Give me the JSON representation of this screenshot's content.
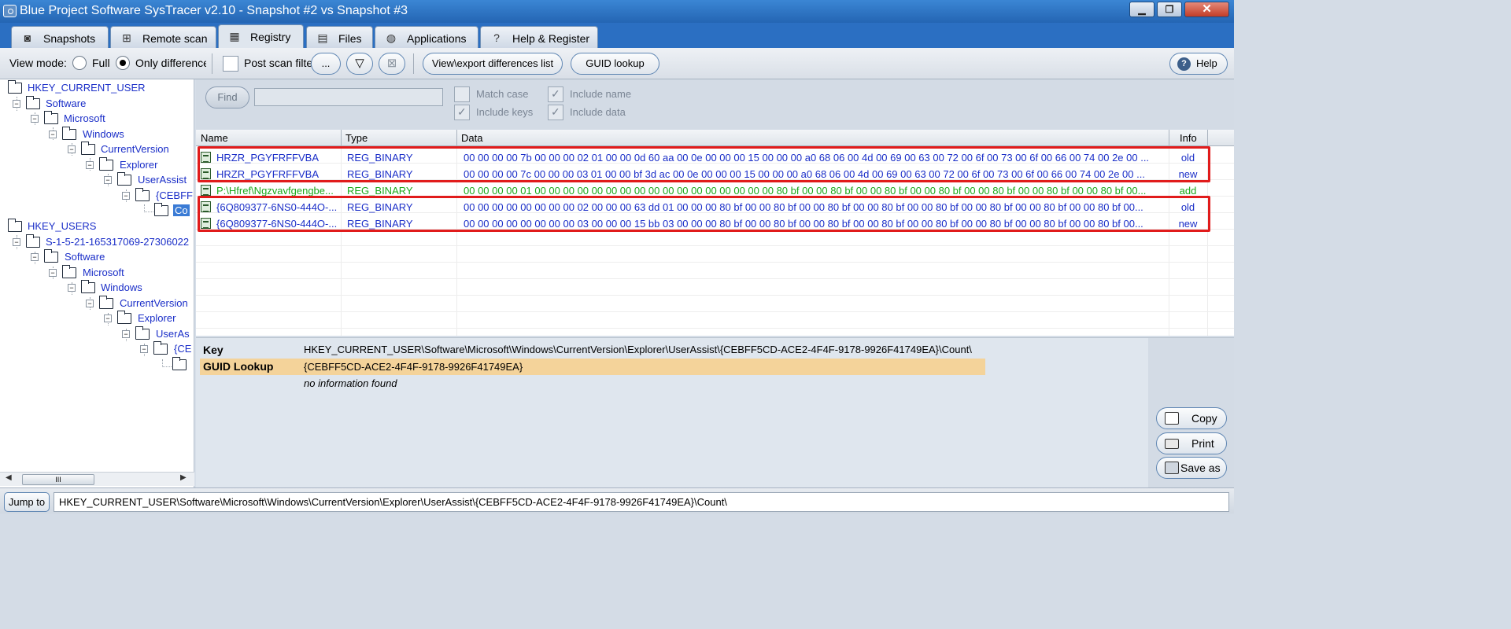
{
  "window": {
    "title": "Blue Project Software SysTracer v2.10 - Snapshot #2 vs Snapshot #3",
    "minimize": "▁",
    "maximize": "❐",
    "close": "✕"
  },
  "tabs": [
    {
      "label": "Snapshots",
      "icon": "camera-icon",
      "glyph": "◙"
    },
    {
      "label": "Remote scan",
      "icon": "network-icon",
      "glyph": "⊞"
    },
    {
      "label": "Registry",
      "icon": "registry-icon",
      "glyph": "▦"
    },
    {
      "label": "Files",
      "icon": "files-icon",
      "glyph": "▤"
    },
    {
      "label": "Applications",
      "icon": "applications-icon",
      "glyph": "◍"
    },
    {
      "label": "Help & Register",
      "icon": "help-icon",
      "glyph": "?"
    }
  ],
  "toolbar": {
    "view_mode_label": "View mode:",
    "full_label": "Full",
    "only_diff_label": "Only differences",
    "view_mode_selected": "Only differences",
    "post_scan_label": "Post scan filte",
    "post_scan_checked": false,
    "more_label": "...",
    "filter_glyph": "▽",
    "clear_filter_glyph": "⊠",
    "view_export_label": "View\\export differences list",
    "guid_lookup_label": "GUID lookup",
    "help_label": "Help",
    "help_glyph": "?"
  },
  "tree": {
    "nodes": [
      {
        "label": "HKEY_CURRENT_USER"
      },
      {
        "label": "Software"
      },
      {
        "label": "Microsoft"
      },
      {
        "label": "Windows"
      },
      {
        "label": "CurrentVersion"
      },
      {
        "label": "Explorer"
      },
      {
        "label": "UserAssist"
      },
      {
        "label": "{CEBFF"
      },
      {
        "label": "Co"
      },
      {
        "label": "HKEY_USERS"
      },
      {
        "label": "S-1-5-21-165317069-27306022"
      },
      {
        "label": "Software"
      },
      {
        "label": "Microsoft"
      },
      {
        "label": "Windows"
      },
      {
        "label": "CurrentVersion"
      },
      {
        "label": "Explorer"
      },
      {
        "label": "UserAs"
      },
      {
        "label": "{CE"
      },
      {
        "label": ""
      }
    ],
    "scroll_grip": "III",
    "scroll_left": "◀",
    "scroll_right": "▶"
  },
  "find": {
    "button_label": "Find",
    "value": "",
    "match_case": {
      "label": "Match case",
      "checked": false
    },
    "include_name": {
      "label": "Include name",
      "checked": true
    },
    "include_keys": {
      "label": "Include keys",
      "checked": true
    },
    "include_data": {
      "label": "Include data",
      "checked": true
    }
  },
  "grid": {
    "columns": [
      "Name",
      "Type",
      "Data",
      "Info"
    ],
    "rows": [
      {
        "name": "HRZR_PGYFRFFVBA",
        "type": "REG_BINARY",
        "data": "00 00 00 00 7b 00 00 00 02 01 00 00 0d 60 aa 00 0e 00 00 00 15 00 00 00 a0 68 06 00 4d 00 69 00 63 00 72 00 6f 00 73 00 6f 00 66 00 74 00 2e 00 ...",
        "info": "old",
        "color": "#1a2ec8"
      },
      {
        "name": "HRZR_PGYFRFFVBA",
        "type": "REG_BINARY",
        "data": "00 00 00 00 7c 00 00 00 03 01 00 00 bf 3d ac 00 0e 00 00 00 15 00 00 00 a0 68 06 00 4d 00 69 00 63 00 72 00 6f 00 73 00 6f 00 66 00 74 00 2e 00 ...",
        "info": "new",
        "color": "#1a2ec8"
      },
      {
        "name": "P:\\Hfref\\Ngzvavfgengbe...",
        "type": "REG_BINARY",
        "data": "00 00 00 00 01 00 00 00 00 00 00 00 00 00 00 00 00 00 00 00 00 00 80 bf 00 00 80 bf 00 00 80 bf 00 00 80 bf 00 00 80 bf 00 00 80 bf 00 00 80 bf 00...",
        "info": "add",
        "color": "#1aa81a"
      },
      {
        "name": "{6Q809377-6NS0-444O-...",
        "type": "REG_BINARY",
        "data": "00 00 00 00 00 00 00 00 02 00 00 00 63 dd 01 00 00 00 80 bf 00 00 80 bf 00 00 80 bf 00 00 80 bf 00 00 80 bf 00 00 80 bf 00 00 80 bf 00 00 80 bf 00...",
        "info": "old",
        "color": "#1a2ec8"
      },
      {
        "name": "{6Q809377-6NS0-444O-...",
        "type": "REG_BINARY",
        "data": "00 00 00 00 00 00 00 00 03 00 00 00 15 bb 03 00 00 00 80 bf 00 00 80 bf 00 00 80 bf 00 00 80 bf 00 00 80 bf 00 00 80 bf 00 00 80 bf 00 00 80 bf 00...",
        "info": "new",
        "color": "#1a2ec8"
      }
    ],
    "highlight_color": "#e11b1b"
  },
  "details": {
    "key_label": "Key",
    "key_value": "HKEY_CURRENT_USER\\Software\\Microsoft\\Windows\\CurrentVersion\\Explorer\\UserAssist\\{CEBFF5CD-ACE2-4F4F-9178-9926F41749EA}\\Count\\",
    "guid_label": "GUID Lookup",
    "guid_value": "{CEBFF5CD-ACE2-4F4F-9178-9926F41749EA}",
    "info_value": "no information found"
  },
  "actions": {
    "copy": "Copy",
    "print": "Print",
    "save_as": "Save as"
  },
  "jump": {
    "button_label": "Jump to",
    "value": "HKEY_CURRENT_USER\\Software\\Microsoft\\Windows\\CurrentVersion\\Explorer\\UserAssist\\{CEBFF5CD-ACE2-4F4F-9178-9926F41749EA}\\Count\\"
  }
}
